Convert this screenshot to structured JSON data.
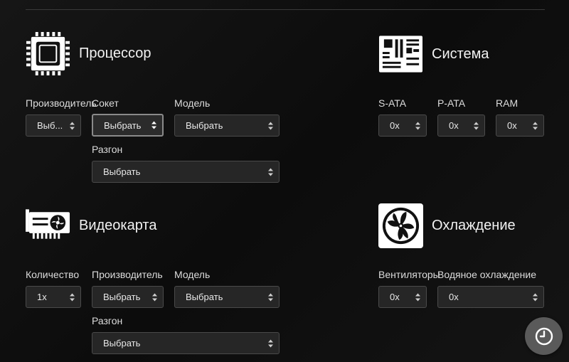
{
  "cpu": {
    "title": "Процессор",
    "icon": "cpu-chip-icon",
    "fields": {
      "manufacturer": {
        "label": "Производитель",
        "value": "Выб..."
      },
      "socket": {
        "label": "Сокет",
        "value": "Выбрать"
      },
      "model": {
        "label": "Модель",
        "value": "Выбрать"
      },
      "overclock": {
        "label": "Разгон",
        "value": "Выбрать"
      }
    }
  },
  "system": {
    "title": "Система",
    "icon": "motherboard-icon",
    "fields": {
      "sata": {
        "label": "S-ATA",
        "value": "0x"
      },
      "pata": {
        "label": "P-ATA",
        "value": "0x"
      },
      "ram": {
        "label": "RAM",
        "value": "0x"
      }
    }
  },
  "gpu": {
    "title": "Видеокарта",
    "icon": "graphics-card-icon",
    "fields": {
      "count": {
        "label": "Количество",
        "value": "1x"
      },
      "manufacturer": {
        "label": "Производитель",
        "value": "Выбрать"
      },
      "model": {
        "label": "Модель",
        "value": "Выбрать"
      },
      "overclock": {
        "label": "Разгон",
        "value": "Выбрать"
      }
    }
  },
  "cooling": {
    "title": "Охлаждение",
    "icon": "fan-icon",
    "fields": {
      "fans": {
        "label": "Вентиляторы",
        "value": "0x"
      },
      "water": {
        "label": "Водяное охлаждение",
        "value": "0x"
      }
    }
  },
  "fab": {
    "icon": "clock-history-icon"
  },
  "colors": {
    "background": "#111111",
    "select_bg": "#262626",
    "fab_bg": "#5a5a5a"
  }
}
